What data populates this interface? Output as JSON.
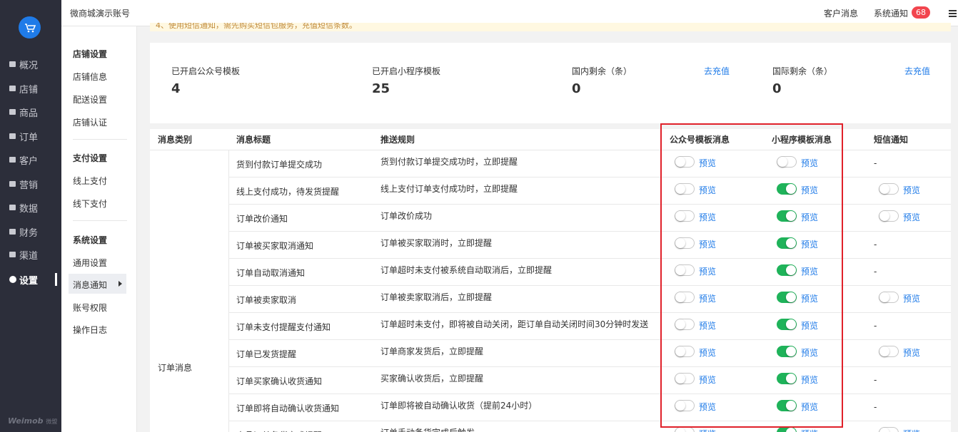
{
  "nav": {
    "items": [
      {
        "label": "概况",
        "icon": "overview-icon"
      },
      {
        "label": "店铺",
        "icon": "store-icon"
      },
      {
        "label": "商品",
        "icon": "goods-icon"
      },
      {
        "label": "订单",
        "icon": "order-icon"
      },
      {
        "label": "客户",
        "icon": "customer-icon"
      },
      {
        "label": "营销",
        "icon": "marketing-icon"
      },
      {
        "label": "数据",
        "icon": "data-icon"
      },
      {
        "label": "财务",
        "icon": "finance-icon"
      },
      {
        "label": "渠道",
        "icon": "channel-icon"
      },
      {
        "label": "设置",
        "icon": "settings-icon"
      }
    ],
    "brand": "Weimob",
    "brand_cn": "微盟"
  },
  "topbar": {
    "store_name": "微商城演示账号",
    "customer_msg": "客户消息",
    "system_notice": "系统通知",
    "badge": "68"
  },
  "subnav": {
    "groups": [
      {
        "title": "店铺设置",
        "items": [
          "店铺信息",
          "配送设置",
          "店铺认证"
        ]
      },
      {
        "title": "支付设置",
        "items": [
          "线上支付",
          "线下支付"
        ]
      },
      {
        "title": "系统设置",
        "items": [
          "通用设置",
          "消息通知",
          "账号权限",
          "操作日志"
        ]
      }
    ]
  },
  "notice": "4、使用短信通知，需先购买短信包服务，充值短信条数。",
  "stats": {
    "items": [
      {
        "label": "已开启公众号模板",
        "value": "4"
      },
      {
        "label": "已开启小程序模板",
        "value": "25"
      },
      {
        "label": "国内剩余（条）",
        "value": "0",
        "link": "去充值"
      },
      {
        "label": "国际剩余（条）",
        "value": "0",
        "link": "去充值"
      }
    ]
  },
  "table": {
    "headers": [
      "消息类别",
      "消息标题",
      "推送规则",
      "公众号模板消息",
      "小程序模板消息",
      "短信通知"
    ],
    "category": "订单消息",
    "preview": "预览",
    "rows": [
      {
        "title": "货到付款订单提交成功",
        "rule": "货到付款订单提交成功时，立即提醒",
        "wx": false,
        "mini": false,
        "sms": null
      },
      {
        "title": "线上支付成功，待发货提醒",
        "rule": "线上支付订单支付成功时，立即提醒",
        "wx": false,
        "mini": true,
        "sms": false
      },
      {
        "title": "订单改价通知",
        "rule": "订单改价成功",
        "wx": false,
        "mini": true,
        "sms": false
      },
      {
        "title": "订单被买家取消通知",
        "rule": "订单被买家取消时，立即提醒",
        "wx": false,
        "mini": true,
        "sms": null
      },
      {
        "title": "订单自动取消通知",
        "rule": "订单超时未支付被系统自动取消后，立即提醒",
        "wx": false,
        "mini": true,
        "sms": null
      },
      {
        "title": "订单被卖家取消",
        "rule": "订单被卖家取消后，立即提醒",
        "wx": false,
        "mini": true,
        "sms": false
      },
      {
        "title": "订单未支付提醒支付通知",
        "rule": "订单超时未支付，即将被自动关闭，距订单自动关闭时间30分钟时发送",
        "wx": false,
        "mini": true,
        "sms": null
      },
      {
        "title": "订单已发货提醒",
        "rule": "订单商家发货后，立即提醒",
        "wx": false,
        "mini": true,
        "sms": false
      },
      {
        "title": "订单买家确认收货通知",
        "rule": "买家确认收货后，立即提醒",
        "wx": false,
        "mini": true,
        "sms": null
      },
      {
        "title": "订单即将自动确认收货通知",
        "rule": "订单即将被自动确认收货（提前24小时）",
        "wx": false,
        "mini": true,
        "sms": null
      },
      {
        "title": "商品订单备货完成提醒",
        "rule": "订单手动备货完成后触发",
        "wx": false,
        "mini": true,
        "sms": false
      }
    ],
    "dash": "-"
  },
  "colors": {
    "accent": "#1f7be8",
    "toggle_on": "#1fb35a",
    "highlight_box": "#e0212a",
    "badge": "#f2454e",
    "nav_bg": "#2c2e3a"
  }
}
